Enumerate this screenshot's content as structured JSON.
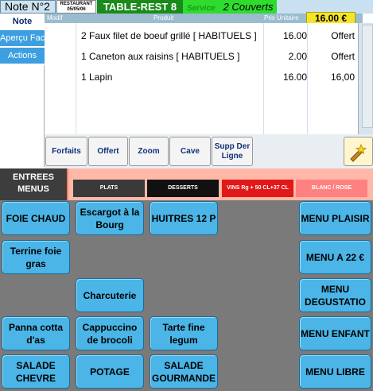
{
  "header": {
    "note": "Note N°2",
    "restaurant_line1": "RESTAURANT",
    "restaurant_line2": "05/05/06",
    "table": "TABLE-REST 8",
    "service_label": "Service",
    "couverts": "2 Couverts",
    "total": "16.00 €"
  },
  "leftnav": {
    "items": [
      {
        "label": "Note"
      },
      {
        "label": "Aperçu Fact"
      },
      {
        "label": "Actions"
      }
    ]
  },
  "order_table": {
    "columns": {
      "modif": "Modif",
      "produit": "Produit",
      "prix": "Prix Unitaire"
    },
    "rows": [
      {
        "desc": "2 Faux filet de boeuf grillé [ HABITUELS ]",
        "price": "16.00",
        "amount": "Offert"
      },
      {
        "desc": "1 Caneton aux raisins [ HABITUELS ]",
        "price": "2.00",
        "amount": "Offert"
      },
      {
        "desc": "1 Lapin",
        "price": "16.00",
        "amount": "16,00"
      }
    ]
  },
  "actions": [
    {
      "label": "Forfaits"
    },
    {
      "label": "Offert"
    },
    {
      "label": "Zoom"
    },
    {
      "label": "Cave"
    },
    {
      "label": "Supp Der Ligne"
    }
  ],
  "tabs": {
    "entrees_line1": "ENTREES",
    "entrees_line2": "MENUS",
    "plats": "PLATS",
    "desserts": "DESSERTS",
    "vins": "VINS Rg + 50 CL+37 CL",
    "blanc": "BLANC / ROSE"
  },
  "menu_buttons": {
    "foie": "FOIE CHAUD",
    "escargot": "Escargot à la Bourg",
    "huitres": "HUITRES 12 P",
    "menu_plaisir": "MENU PLAISIR",
    "terrine": "Terrine foie gras",
    "menu_22": "MENU A 22 €",
    "charcuterie": "Charcuterie",
    "menu_degustation": "MENU DEGUSTATIO",
    "panna": "Panna cotta d'as",
    "cappuccino": "Cappuccino de brocoli",
    "tarte": "Tarte fine legum",
    "menu_enfant": "MENU ENFANT",
    "salade_chevre": "SALADE CHEVRE",
    "potage": "POTAGE",
    "salade_gourmande": "SALADE GOURMANDE",
    "menu_libre": "MENU LIBRE"
  },
  "colors": {
    "menu_button": "#4ab5e6",
    "table_badge": "#1a8a1a",
    "service_badge": "#2edc2e",
    "total_badge": "#f5e42a",
    "nav_active": "#3d9fe0"
  }
}
